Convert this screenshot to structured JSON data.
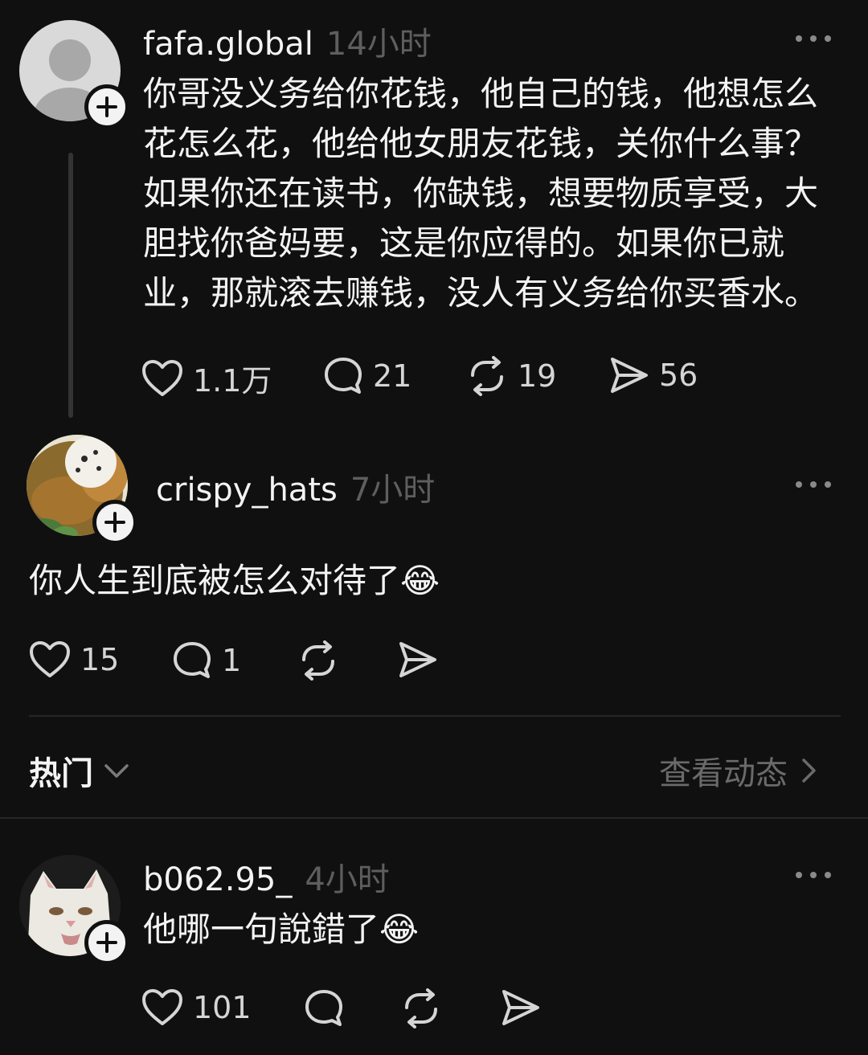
{
  "posts": [
    {
      "username": "fafa.global",
      "time": "14小时",
      "text_lines": [
        "你哥没义务给你花钱，他自己的钱，他想怎么",
        "花怎么花，他给他女朋友花钱，关你什么事？",
        "如果你还在读书，你缺钱，想要物质享受，大",
        "胆找你爸妈要，这是你应得的。如果你已就",
        "业，那就滚去赚钱，没人有义务给你买香水。"
      ],
      "likes": "1.1万",
      "comments": "21",
      "reposts": "19",
      "shares": "56"
    },
    {
      "username": "crispy_hats",
      "time": "7小时",
      "text": "你人生到底被怎么对待了",
      "emoji": "😂",
      "likes": "15",
      "comments": "1"
    }
  ],
  "sort_bar": {
    "label": "热门",
    "view_activity": "查看动态"
  },
  "replies": [
    {
      "username": "b062.95_",
      "time": "4小时",
      "text": "他哪一句說錯了",
      "emoji": "😂",
      "likes": "101"
    }
  ],
  "icons": [
    "heart-icon",
    "comment-icon",
    "repost-icon",
    "share-icon",
    "more-icon",
    "plus-icon",
    "chevron-down-icon",
    "chevron-right-icon"
  ],
  "colors": {
    "background": "#101010",
    "text": "#f3f3f3",
    "muted": "#5e5e5e",
    "divider": "#262626"
  }
}
